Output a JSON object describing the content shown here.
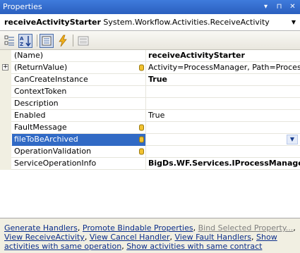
{
  "window": {
    "title": "Properties",
    "buttons": [
      "▾",
      "⊓",
      "✕"
    ]
  },
  "object_selector": {
    "name": "receiveActivityStarter",
    "type": "System.Workflow.Activities.ReceiveActivity"
  },
  "toolbar": {
    "buttons": [
      "categorized-icon",
      "alphabetical-icon",
      "properties-icon",
      "events-icon",
      "property-pages-icon"
    ]
  },
  "properties": [
    {
      "name": "(Name)",
      "value": "receiveActivityStarter",
      "bold": true,
      "bindable": false,
      "expandable": false,
      "selected": false
    },
    {
      "name": "(ReturnValue)",
      "value": "Activity=ProcessManager, Path=ProcessRes",
      "bold": false,
      "bindable": true,
      "expandable": true,
      "selected": false
    },
    {
      "name": "CanCreateInstance",
      "value": "True",
      "bold": true,
      "bindable": false,
      "expandable": false,
      "selected": false
    },
    {
      "name": "ContextToken",
      "value": "",
      "bold": false,
      "bindable": false,
      "expandable": false,
      "selected": false
    },
    {
      "name": "Description",
      "value": "",
      "bold": false,
      "bindable": false,
      "expandable": false,
      "selected": false
    },
    {
      "name": "Enabled",
      "value": "True",
      "bold": false,
      "bindable": false,
      "expandable": false,
      "selected": false
    },
    {
      "name": "FaultMessage",
      "value": "",
      "bold": false,
      "bindable": true,
      "expandable": false,
      "selected": false
    },
    {
      "name": "fileToBeArchived",
      "value": "",
      "bold": false,
      "bindable": true,
      "expandable": false,
      "selected": true
    },
    {
      "name": "OperationValidation",
      "value": "",
      "bold": false,
      "bindable": true,
      "expandable": false,
      "selected": false
    },
    {
      "name": "ServiceOperationInfo",
      "value": "BigDs.WF.Services.IProcessManagerSe",
      "bold": true,
      "bindable": false,
      "expandable": false,
      "selected": false
    }
  ],
  "commands": [
    {
      "label": "Generate Handlers",
      "sep": ", ",
      "enabled": true
    },
    {
      "label": "Promote Bindable Properties",
      "sep": ", ",
      "enabled": true
    },
    {
      "label": "Bind Selected Property...",
      "sep": ", ",
      "enabled": false
    },
    {
      "label": "View ReceiveActivity",
      "sep": ", ",
      "enabled": true
    },
    {
      "label": "View Cancel Handler",
      "sep": ", ",
      "enabled": true
    },
    {
      "label": "View Fault Handlers",
      "sep": ", ",
      "enabled": true
    },
    {
      "label": "Show activities with same operation",
      "sep": ", ",
      "enabled": true
    },
    {
      "label": "Show activities with same contract",
      "sep": "",
      "enabled": true
    }
  ],
  "colors": {
    "title_bar": "#2a5fbf",
    "selection": "#316ac5",
    "link": "#0a2d8a",
    "gutter": "#f1efe2"
  }
}
